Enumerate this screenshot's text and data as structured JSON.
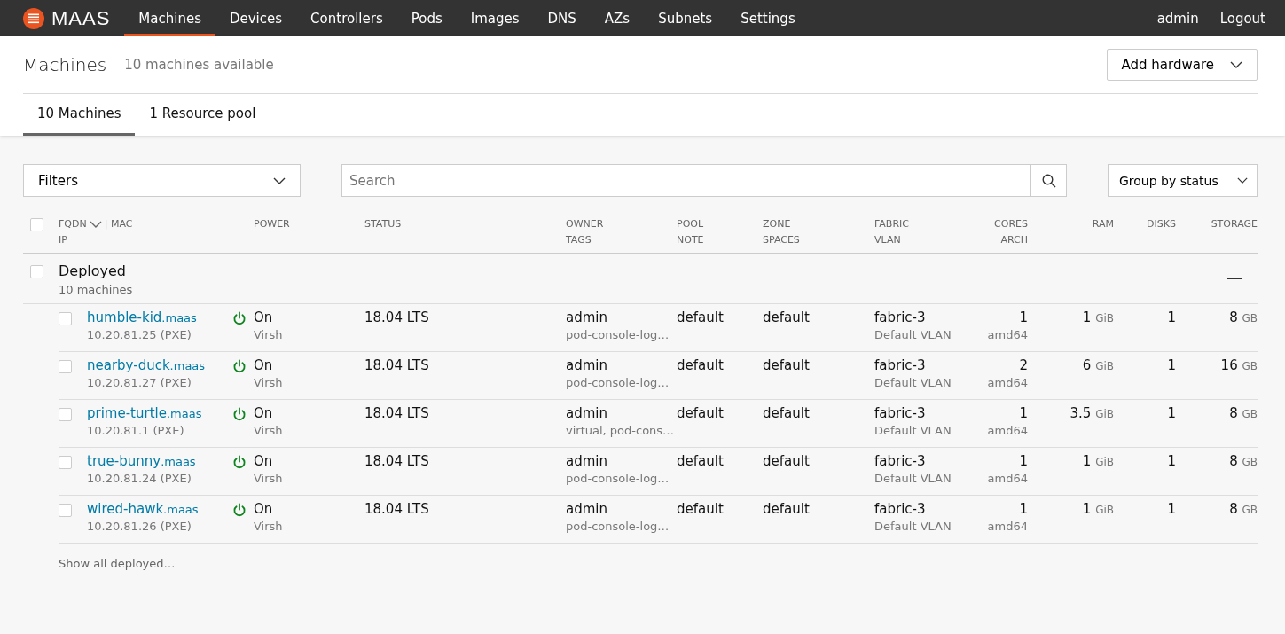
{
  "nav": {
    "brand": "MAAS",
    "items": [
      {
        "label": "Machines",
        "selected": true
      },
      {
        "label": "Devices",
        "selected": false
      },
      {
        "label": "Controllers",
        "selected": false
      },
      {
        "label": "Pods",
        "selected": false
      },
      {
        "label": "Images",
        "selected": false
      },
      {
        "label": "DNS",
        "selected": false
      },
      {
        "label": "AZs",
        "selected": false
      },
      {
        "label": "Subnets",
        "selected": false
      },
      {
        "label": "Settings",
        "selected": false
      }
    ],
    "user_links": [
      "admin",
      "Logout"
    ]
  },
  "header": {
    "title": "Machines",
    "subtitle": "10 machines available",
    "add_button": "Add hardware"
  },
  "tabs": [
    {
      "label": "10 Machines",
      "selected": true
    },
    {
      "label": "1 Resource pool",
      "selected": false
    }
  ],
  "toolbar": {
    "filters": "Filters",
    "search": {
      "placeholder": "Search"
    },
    "group_by": "Group by status"
  },
  "table": {
    "select_all_checked": false,
    "columns": [
      {
        "top": "FQDN",
        "extra": "| MAC",
        "bottom": "IP"
      },
      {
        "top": "POWER"
      },
      {
        "top": "STATUS"
      },
      {
        "top": "OWNER",
        "bottom": "TAGS"
      },
      {
        "top": "POOL",
        "bottom": "NOTE"
      },
      {
        "top": "ZONE",
        "bottom": "SPACES"
      },
      {
        "top": "FABRIC",
        "bottom": "VLAN"
      },
      {
        "top": "CORES",
        "bottom": "ARCH"
      },
      {
        "top": "RAM"
      },
      {
        "top": "DISKS"
      },
      {
        "top": "STORAGE"
      }
    ],
    "group": {
      "label": "Deployed",
      "count": "10 machines",
      "checked": false,
      "expanded": true
    },
    "rows": [
      {
        "checked": false,
        "host": "humble-kid",
        "domain": ".maas",
        "ip": "10.20.81.25 (PXE)",
        "power_on": true,
        "power": "On",
        "power_type": "Virsh",
        "status": "18.04 LTS",
        "owner": "admin",
        "tags": "pod-console-log…",
        "pool": "default",
        "zone": "default",
        "fabric": "fabric-3",
        "vlan": "Default VLAN",
        "cores": "1",
        "arch": "amd64",
        "ram": "1",
        "ram_unit": "GiB",
        "disks": "1",
        "storage": "8",
        "storage_unit": "GB"
      },
      {
        "checked": false,
        "host": "nearby-duck",
        "domain": ".maas",
        "ip": "10.20.81.27 (PXE)",
        "power_on": true,
        "power": "On",
        "power_type": "Virsh",
        "status": "18.04 LTS",
        "owner": "admin",
        "tags": "pod-console-log…",
        "pool": "default",
        "zone": "default",
        "fabric": "fabric-3",
        "vlan": "Default VLAN",
        "cores": "2",
        "arch": "amd64",
        "ram": "6",
        "ram_unit": "GiB",
        "disks": "1",
        "storage": "16",
        "storage_unit": "GB"
      },
      {
        "checked": false,
        "host": "prime-turtle",
        "domain": ".maas",
        "ip": "10.20.81.1 (PXE)",
        "power_on": true,
        "power": "On",
        "power_type": "Virsh",
        "status": "18.04 LTS",
        "owner": "admin",
        "tags": "virtual, pod-cons…",
        "pool": "default",
        "zone": "default",
        "fabric": "fabric-3",
        "vlan": "Default VLAN",
        "cores": "1",
        "arch": "amd64",
        "ram": "3.5",
        "ram_unit": "GiB",
        "disks": "1",
        "storage": "8",
        "storage_unit": "GB"
      },
      {
        "checked": false,
        "host": "true-bunny",
        "domain": ".maas",
        "ip": "10.20.81.24 (PXE)",
        "power_on": true,
        "power": "On",
        "power_type": "Virsh",
        "status": "18.04 LTS",
        "owner": "admin",
        "tags": "pod-console-log…",
        "pool": "default",
        "zone": "default",
        "fabric": "fabric-3",
        "vlan": "Default VLAN",
        "cores": "1",
        "arch": "amd64",
        "ram": "1",
        "ram_unit": "GiB",
        "disks": "1",
        "storage": "8",
        "storage_unit": "GB"
      },
      {
        "checked": false,
        "host": "wired-hawk",
        "domain": ".maas",
        "ip": "10.20.81.26 (PXE)",
        "power_on": true,
        "power": "On",
        "power_type": "Virsh",
        "status": "18.04 LTS",
        "owner": "admin",
        "tags": "pod-console-log…",
        "pool": "default",
        "zone": "default",
        "fabric": "fabric-3",
        "vlan": "Default VLAN",
        "cores": "1",
        "arch": "amd64",
        "ram": "1",
        "ram_unit": "GiB",
        "disks": "1",
        "storage": "8",
        "storage_unit": "GB"
      }
    ],
    "show_all": "Show all deployed…"
  }
}
